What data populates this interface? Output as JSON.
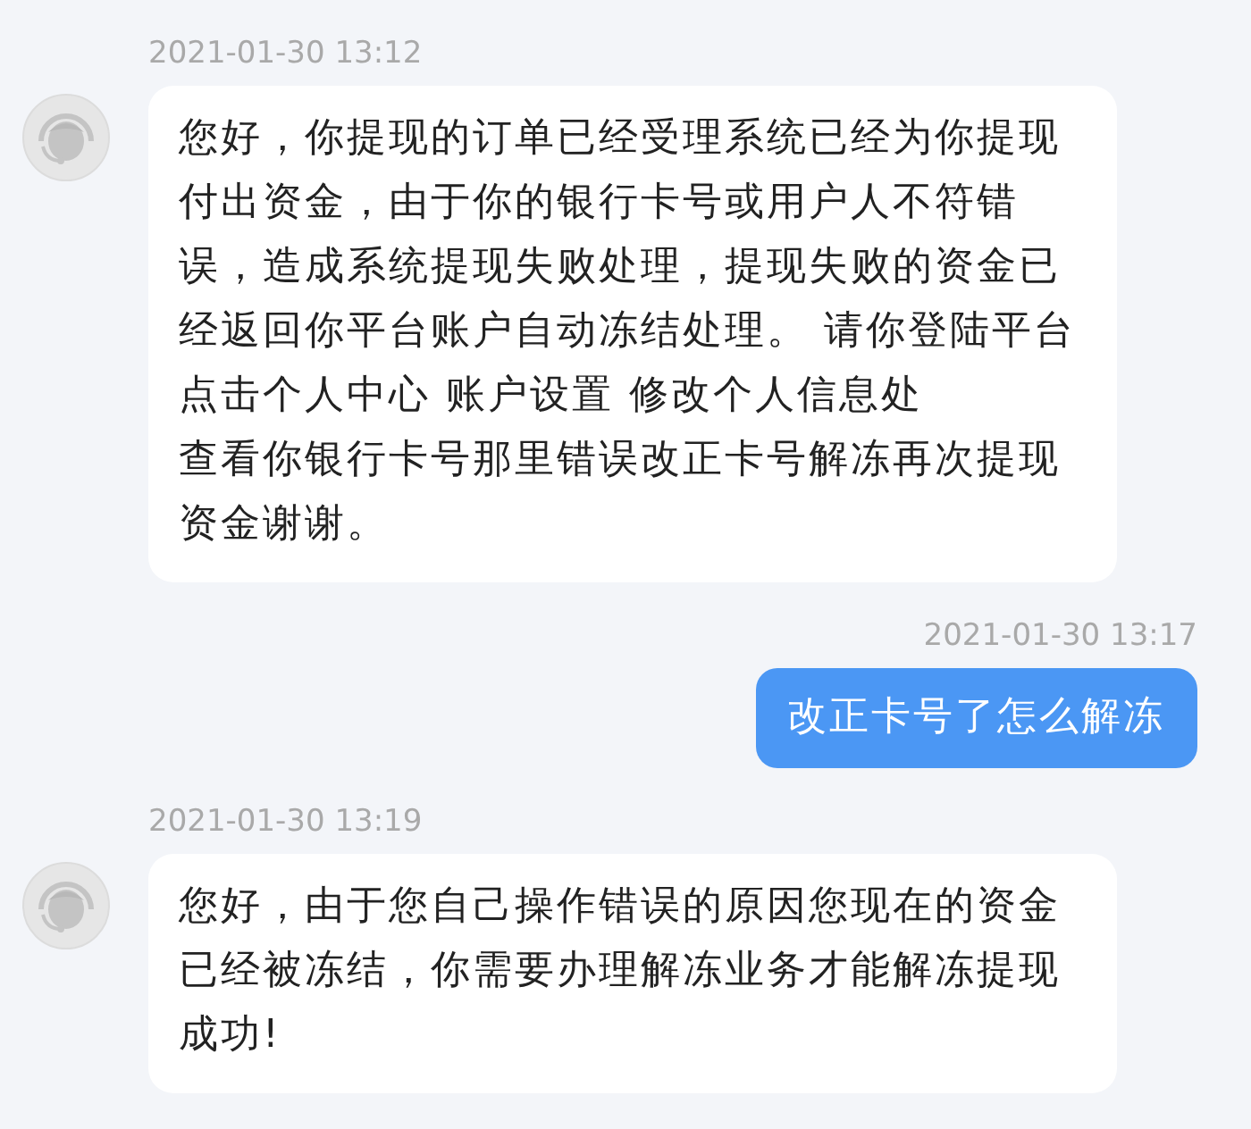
{
  "messages": [
    {
      "kind": "received",
      "time": "2021-01-30 13:12",
      "paragraphs": [
        "您好，你提现的订单已经受理系统已经为你提现付出资金，由于你的银行卡号或用户人不符错误，造成系统提现失败处理，提现失败的资金已经返回你平台账户自动冻结处理。 请你登陆平台点击个人中心 账户设置 修改个人信息处",
        "查看你银行卡号那里错误改正卡号解冻再次提现资金谢谢。"
      ]
    },
    {
      "kind": "sent",
      "time": "2021-01-30 13:17",
      "paragraphs": [
        "改正卡号了怎么解冻"
      ]
    },
    {
      "kind": "received",
      "time": "2021-01-30 13:19",
      "paragraphs": [
        "您好，由于您自己操作错误的原因您现在的资金已经被冻结，你需要办理解冻业务才能解冻提现成功!"
      ]
    }
  ]
}
